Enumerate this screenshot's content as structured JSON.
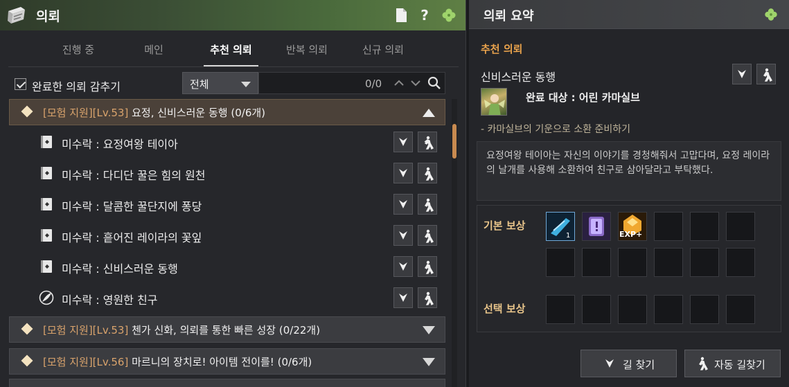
{
  "left_panel": {
    "title": "의뢰",
    "header_icons": [
      "document-icon",
      "help-icon",
      "clover-icon"
    ],
    "help_glyph": "?",
    "tabs": [
      {
        "label": "진행 중",
        "active": false
      },
      {
        "label": "메인",
        "active": false
      },
      {
        "label": "추천 의뢰",
        "active": true
      },
      {
        "label": "반복 의뢰",
        "active": false
      },
      {
        "label": "신규 의뢰",
        "active": false
      }
    ],
    "filter": {
      "hide_completed_label": "완료한 의뢰 감추기",
      "hide_completed_checked": true,
      "dropdown_value": "전체",
      "search_count": "0/0"
    },
    "groups": [
      {
        "category": "[모험 지원][Lv.53]",
        "name": "요정, 신비스러운 동행 (0/6개)",
        "expanded": true,
        "items": [
          {
            "label": "미수락 : 요정여왕 테이아",
            "icon": "quest-book-icon"
          },
          {
            "label": "미수락 : 다디단 꿀은 힘의 원천",
            "icon": "quest-book-icon"
          },
          {
            "label": "미수락 : 달콤한 꿀단지에 퐁당",
            "icon": "quest-book-icon"
          },
          {
            "label": "미수락 : 흩어진 레이라의 꽃잎",
            "icon": "quest-book-icon"
          },
          {
            "label": "미수락 : 신비스러운 동행",
            "icon": "quest-book-icon"
          },
          {
            "label": "미수락 : 영원한 친구",
            "icon": "quill-icon"
          }
        ]
      },
      {
        "category": "[모험 지원][Lv.53]",
        "name": "첸가 신화, 의뢰를 통한 빠른 성장 (0/22개)",
        "expanded": false
      },
      {
        "category": "[모험 지원][Lv.56]",
        "name": "마르니의 장치로! 아이템 전이를! (0/6개)",
        "expanded": false
      }
    ]
  },
  "right_panel": {
    "title": "의뢰 요약",
    "section_label": "추천 의뢰",
    "quest_name": "신비스러운 동행",
    "target": "완료 대상 : 어린 카마실브",
    "subtask": "- 카마실브의 기운으로 소환 준비하기",
    "description": "요정여왕 테이아는 자신의 이야기를 경청해줘서 고맙다며, 요정 레이라의 날개를 사용해 소환하여 친구로 삼아달라고 부탁했다.",
    "base_reward_label": "기본 보상",
    "choice_reward_label": "선택 보상",
    "base_rewards": [
      {
        "icon": "blue-whistle-icon",
        "name": "blue item"
      },
      {
        "icon": "purple-scroll-icon",
        "name": "purple scroll"
      },
      {
        "icon": "exp-orb-icon",
        "name": "EXP+"
      }
    ],
    "exp_label": "EXP+",
    "navigate_button": "길 찾기",
    "auto_navigate_button": "자동 길찾기"
  },
  "colors": {
    "accent_orange": "#e8a24c",
    "category_orange": "#d9a36c",
    "expanded_group_bg": "#4b4139",
    "scroll_thumb": "#c88a50"
  }
}
